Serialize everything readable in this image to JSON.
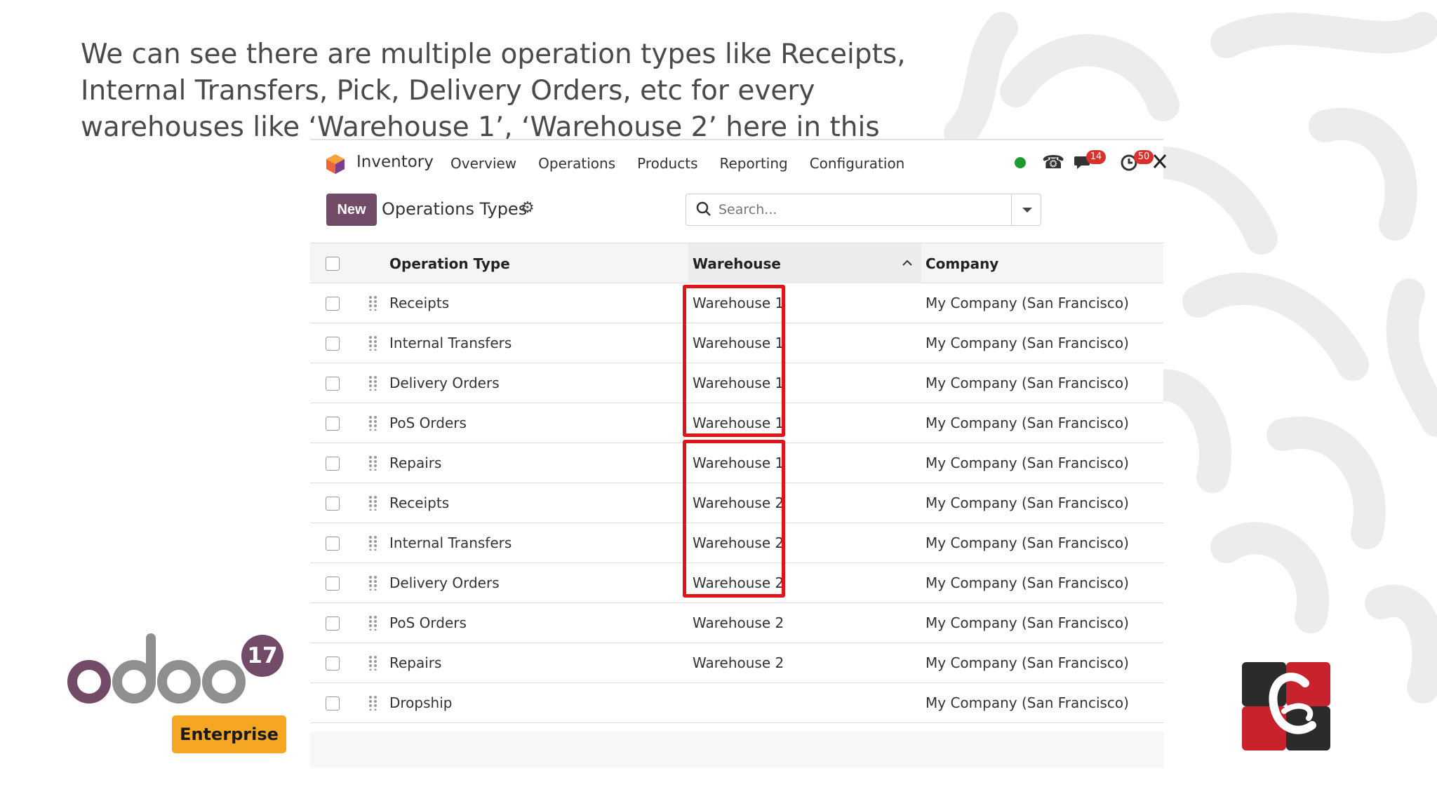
{
  "caption": "We can see there are multiple operation types like Receipts, Internal Transfers, Pick, Delivery Orders, etc for every warehouses like ‘Warehouse 1’, ‘Warehouse 2’ here in this example.",
  "appbar": {
    "app_name": "Inventory",
    "menu": [
      "Overview",
      "Operations",
      "Products",
      "Reporting",
      "Configuration"
    ],
    "messages_count": "14",
    "activities_count": "50"
  },
  "control": {
    "new_label": "New",
    "title": "Operations Types",
    "search_placeholder": "Search..."
  },
  "table": {
    "columns": [
      "Operation Type",
      "Warehouse",
      "Company"
    ],
    "sort_column": "Warehouse",
    "rows": [
      {
        "op": "Receipts",
        "wh": "Warehouse 1",
        "co": "My Company (San Francisco)"
      },
      {
        "op": "Internal Transfers",
        "wh": "Warehouse 1",
        "co": "My Company (San Francisco)"
      },
      {
        "op": "Delivery Orders",
        "wh": "Warehouse 1",
        "co": "My Company (San Francisco)"
      },
      {
        "op": "PoS Orders",
        "wh": "Warehouse 1",
        "co": "My Company (San Francisco)"
      },
      {
        "op": "Repairs",
        "wh": "Warehouse 1",
        "co": "My Company (San Francisco)"
      },
      {
        "op": "Receipts",
        "wh": "Warehouse 2",
        "co": "My Company (San Francisco)"
      },
      {
        "op": "Internal Transfers",
        "wh": "Warehouse 2",
        "co": "My Company (San Francisco)"
      },
      {
        "op": "Delivery Orders",
        "wh": "Warehouse 2",
        "co": "My Company (San Francisco)"
      },
      {
        "op": "PoS Orders",
        "wh": "Warehouse 2",
        "co": "My Company (San Francisco)"
      },
      {
        "op": "Repairs",
        "wh": "Warehouse 2",
        "co": "My Company (San Francisco)"
      },
      {
        "op": "Dropship",
        "wh": "",
        "co": "My Company (San Francisco)"
      }
    ]
  },
  "branding": {
    "odoo_wordmark": "odoo",
    "version": "17",
    "edition": "Enterprise"
  },
  "colors": {
    "brand_purple": "#714b67",
    "highlight_red": "#e0141b",
    "enterprise_orange": "#f5a623",
    "online_green": "#1e9b2e"
  }
}
